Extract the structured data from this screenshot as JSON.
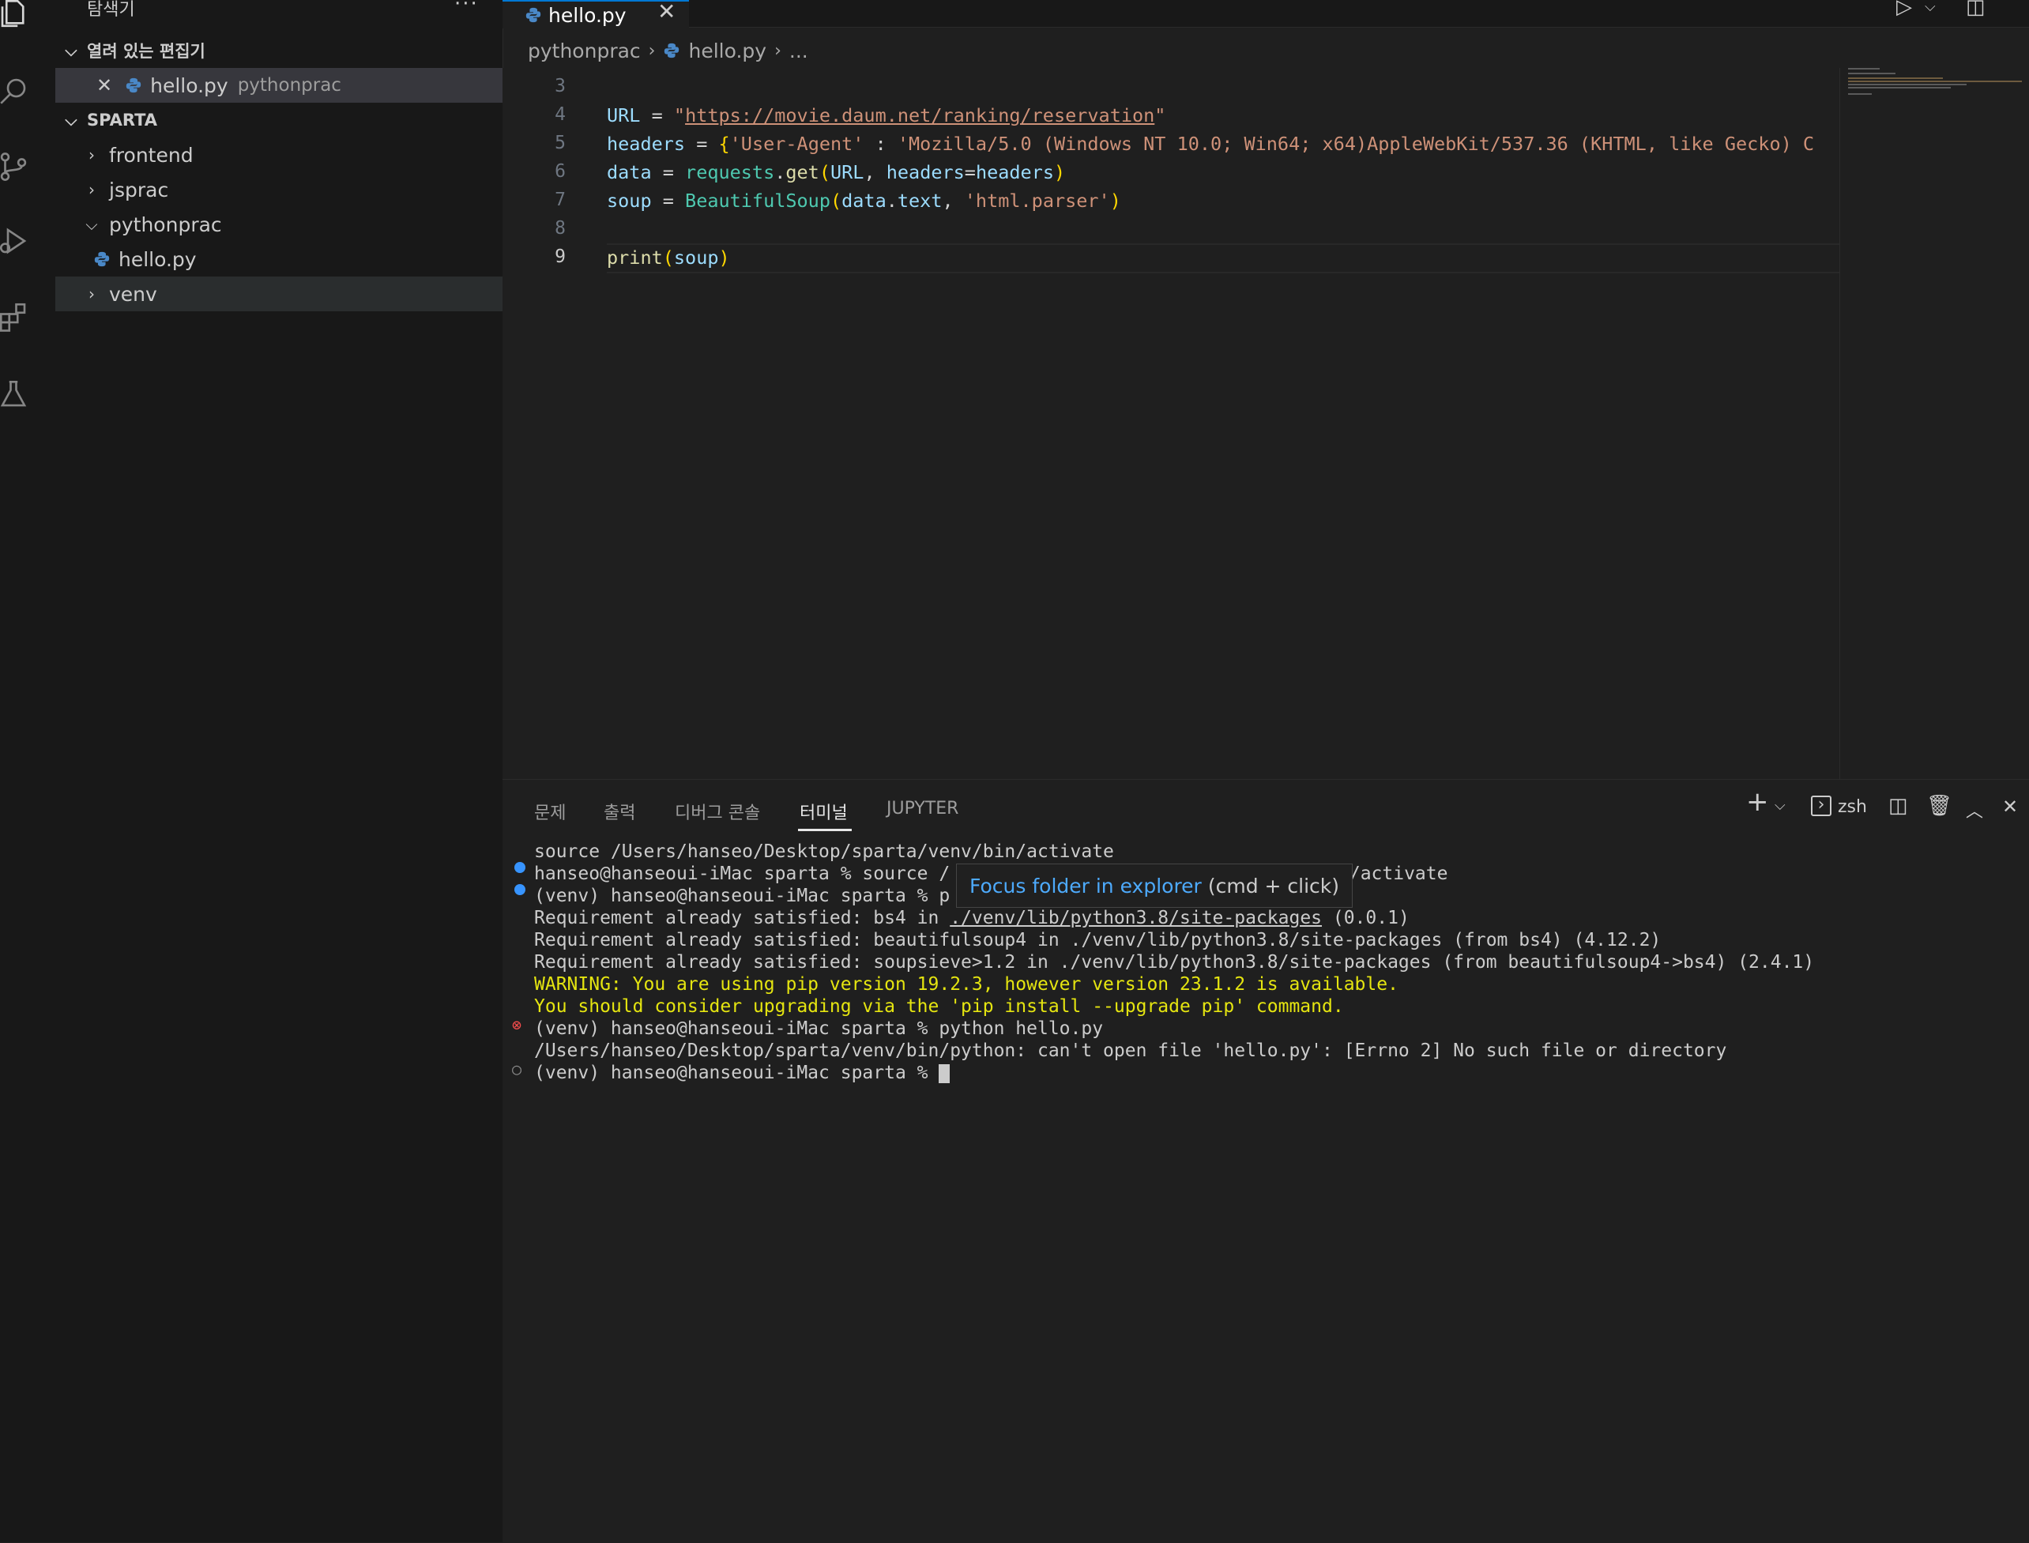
{
  "sidebar": {
    "title": "탐색기",
    "more": "···",
    "open_editors_label": "열려 있는 편집기",
    "open_editors": [
      {
        "name": "hello.py",
        "folder": "pythonprac"
      }
    ],
    "workspace_label": "SPARTA",
    "tree": [
      {
        "label": "frontend"
      },
      {
        "label": "jsprac"
      },
      {
        "label": "pythonprac"
      },
      {
        "label": "hello.py"
      },
      {
        "label": "venv"
      }
    ]
  },
  "tabs": [
    {
      "label": "hello.py"
    }
  ],
  "breadcrumb": [
    "pythonprac",
    "hello.py",
    "..."
  ],
  "editor": {
    "line_numbers": [
      "3",
      "4",
      "5",
      "6",
      "7",
      "8",
      "9"
    ],
    "lines": {
      "l4_var": "URL",
      "l4_eq": " = ",
      "l4_q1": "\"",
      "l4_url": "https://movie.daum.net/ranking/reservation",
      "l4_q2": "\"",
      "l5_var": "headers",
      "l5_eq": " = ",
      "l5_br": "{",
      "l5_key": "'User-Agent'",
      "l5_colon": " : ",
      "l5_val": "'Mozilla/5.0 (Windows NT 10.0; Win64; x64)AppleWebKit/537.36 (KHTML, like Gecko) C",
      "l6_var": "data",
      "l6_eq": " = ",
      "l6_mod": "requests",
      "l6_dot": ".",
      "l6_fn": "get",
      "l6_p1": "(",
      "l6_a1": "URL",
      "l6_c": ", ",
      "l6_a2": "headers",
      "l6_eq2": "=",
      "l6_a3": "headers",
      "l6_p2": ")",
      "l7_var": "soup",
      "l7_eq": " = ",
      "l7_cls": "BeautifulSoup",
      "l7_p1": "(",
      "l7_a1": "data",
      "l7_dot": ".",
      "l7_a2": "text",
      "l7_c": ", ",
      "l7_s": "'html.parser'",
      "l7_p2": ")",
      "l9_fn": "print",
      "l9_p1": "(",
      "l9_a": "soup",
      "l9_p2": ")"
    }
  },
  "panel": {
    "tabs": [
      "문제",
      "출력",
      "디버그 콘솔",
      "터미널",
      "JUPYTER"
    ],
    "active_tab": "터미널",
    "shell": "zsh",
    "terminal": [
      "source /Users/hanseo/Desktop/sparta/venv/bin/activate",
      "hanseo@hanseoui-iMac sparta % source /",
      "n/activate",
      "(venv) hanseo@hanseoui-iMac sparta % p",
      "Requirement already satisfied: bs4 in ",
      "./venv/lib/python3.8/site-packages",
      " (0.0.1)",
      "Requirement already satisfied: beautifulsoup4 in ./venv/lib/python3.8/site-packages (from bs4) (4.12.2)",
      "Requirement already satisfied: soupsieve>1.2 in ./venv/lib/python3.8/site-packages (from beautifulsoup4->bs4) (2.4.1)",
      "WARNING: You are using pip version 19.2.3, however version 23.1.2 is available.",
      "You should consider upgrading via the 'pip install --upgrade pip' command.",
      "(venv) hanseo@hanseoui-iMac sparta % python hello.py",
      "/Users/hanseo/Desktop/sparta/venv/bin/python: can't open file 'hello.py': [Errno 2] No such file or directory",
      "(venv) hanseo@hanseoui-iMac sparta % "
    ]
  },
  "tooltip": {
    "link": "Focus folder in explorer",
    "hint": "(cmd + click)"
  },
  "colors": {
    "accent": "#0078d4",
    "warning": "#e5e510",
    "error": "#f14c4c",
    "info_dot": "#3794ff"
  }
}
